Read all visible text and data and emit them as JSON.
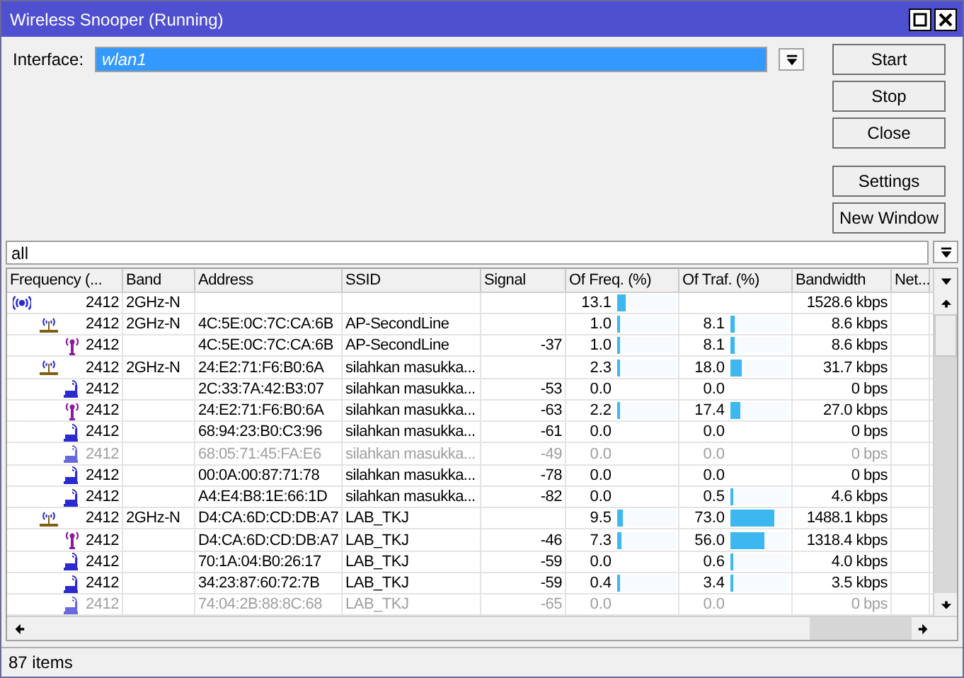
{
  "window": {
    "title": "Wireless Snooper (Running)"
  },
  "interface": {
    "label": "Interface:",
    "value": "wlan1"
  },
  "buttons": [
    "Start",
    "Stop",
    "Close",
    "Settings",
    "New Window"
  ],
  "filter": {
    "value": "all"
  },
  "table": {
    "columns": [
      "Frequency (...",
      "Band",
      "Address",
      "SSID",
      "Signal",
      "Of Freq. (%)",
      "Of Traf. (%)",
      "Bandwidth",
      "Net..."
    ],
    "rows": [
      {
        "kind": "channel",
        "dimmed": false,
        "frequency": "2412",
        "band": "2GHz-N",
        "of_freq": {
          "text": "13.1",
          "level": 0.131
        },
        "of_traf": {
          "level": 0
        },
        "bandwidth": "1528.6 kbps",
        "children": [
          {
            "kind": "ap",
            "dimmed": false,
            "frequency": "2412",
            "band": "2GHz-N",
            "address": "4C:5E:0C:7C:CA:6B",
            "ssid": "AP-SecondLine",
            "of_freq": {
              "text": "1.0",
              "level": 0.01
            },
            "of_traf": {
              "text": "8.1",
              "level": 0.081
            },
            "bandwidth": "8.6 kbps",
            "children": [
              {
                "kind": "radio",
                "dimmed": false,
                "frequency": "2412",
                "address": "4C:5E:0C:7C:CA:6B",
                "ssid": "AP-SecondLine",
                "signal": "-37",
                "of_freq": {
                  "text": "1.0",
                  "level": 0.01
                },
                "of_traf": {
                  "text": "8.1",
                  "level": 0.081
                },
                "bandwidth": "8.6 kbps"
              }
            ]
          },
          {
            "kind": "ap",
            "dimmed": false,
            "frequency": "2412",
            "band": "2GHz-N",
            "address": "24:E2:71:F6:B0:6A",
            "ssid": "silahkan masukka...",
            "of_freq": {
              "text": "2.3",
              "level": 0.023
            },
            "of_traf": {
              "text": "18.0",
              "level": 0.18
            },
            "bandwidth": "31.7 kbps",
            "children": [
              {
                "kind": "station",
                "dimmed": false,
                "frequency": "2412",
                "address": "2C:33:7A:42:B3:07",
                "ssid": "silahkan masukka...",
                "signal": "-53",
                "of_freq": {
                  "text": "0.0",
                  "level": 0
                },
                "of_traf": {
                  "text": "0.0",
                  "level": 0
                },
                "bandwidth": "0 bps"
              },
              {
                "kind": "radio",
                "dimmed": false,
                "frequency": "2412",
                "address": "24:E2:71:F6:B0:6A",
                "ssid": "silahkan masukka...",
                "signal": "-63",
                "of_freq": {
                  "text": "2.2",
                  "level": 0.022
                },
                "of_traf": {
                  "text": "17.4",
                  "level": 0.174
                },
                "bandwidth": "27.0 kbps"
              },
              {
                "kind": "station",
                "dimmed": false,
                "frequency": "2412",
                "address": "68:94:23:B0:C3:96",
                "ssid": "silahkan masukka...",
                "signal": "-61",
                "of_freq": {
                  "text": "0.0",
                  "level": 0
                },
                "of_traf": {
                  "text": "0.0",
                  "level": 0
                },
                "bandwidth": "0 bps"
              },
              {
                "kind": "station",
                "dimmed": true,
                "frequency": "2412",
                "address": "68:05:71:45:FA:E6",
                "ssid": "silahkan masukka...",
                "signal": "-49",
                "of_freq": {
                  "text": "0.0",
                  "level": 0
                },
                "of_traf": {
                  "text": "0.0",
                  "level": 0
                },
                "bandwidth": "0 bps"
              },
              {
                "kind": "station",
                "dimmed": false,
                "frequency": "2412",
                "address": "00:0A:00:87:71:78",
                "ssid": "silahkan masukka...",
                "signal": "-78",
                "of_freq": {
                  "text": "0.0",
                  "level": 0
                },
                "of_traf": {
                  "text": "0.0",
                  "level": 0
                },
                "bandwidth": "0 bps"
              },
              {
                "kind": "station",
                "dimmed": false,
                "frequency": "2412",
                "address": "A4:E4:B8:1E:66:1D",
                "ssid": "silahkan masukka...",
                "signal": "-82",
                "of_freq": {
                  "text": "0.0",
                  "level": 0
                },
                "of_traf": {
                  "text": "0.5",
                  "level": 0.005
                },
                "bandwidth": "4.6 kbps"
              }
            ]
          },
          {
            "kind": "ap",
            "dimmed": false,
            "frequency": "2412",
            "band": "2GHz-N",
            "address": "D4:CA:6D:CD:DB:A7",
            "ssid": "LAB_TKJ",
            "of_freq": {
              "text": "9.5",
              "level": 0.095
            },
            "of_traf": {
              "text": "73.0",
              "level": 0.73
            },
            "bandwidth": "1488.1 kbps",
            "children": [
              {
                "kind": "radio",
                "dimmed": false,
                "frequency": "2412",
                "address": "D4:CA:6D:CD:DB:A7",
                "ssid": "LAB_TKJ",
                "signal": "-46",
                "of_freq": {
                  "text": "7.3",
                  "level": 0.073
                },
                "of_traf": {
                  "text": "56.0",
                  "level": 0.56
                },
                "bandwidth": "1318.4 kbps"
              },
              {
                "kind": "station",
                "dimmed": false,
                "frequency": "2412",
                "address": "70:1A:04:B0:26:17",
                "ssid": "LAB_TKJ",
                "signal": "-59",
                "of_freq": {
                  "text": "0.0",
                  "level": 0
                },
                "of_traf": {
                  "text": "0.6",
                  "level": 0.006
                },
                "bandwidth": "4.0 kbps"
              },
              {
                "kind": "station",
                "dimmed": false,
                "frequency": "2412",
                "address": "34:23:87:60:72:7B",
                "ssid": "LAB_TKJ",
                "signal": "-59",
                "of_freq": {
                  "text": "0.4",
                  "level": 0.004
                },
                "of_traf": {
                  "text": "3.4",
                  "level": 0.034
                },
                "bandwidth": "3.5 kbps"
              },
              {
                "kind": "station",
                "dimmed": true,
                "frequency": "2412",
                "address": "74:04:2B:88:8C:68",
                "ssid": "LAB_TKJ",
                "signal": "-65",
                "of_freq": {
                  "text": "0.0",
                  "level": 0
                },
                "of_traf": {
                  "text": "0.0",
                  "level": 0
                },
                "bandwidth": "0 bps"
              }
            ]
          }
        ]
      }
    ]
  },
  "status_bar": "87 items"
}
